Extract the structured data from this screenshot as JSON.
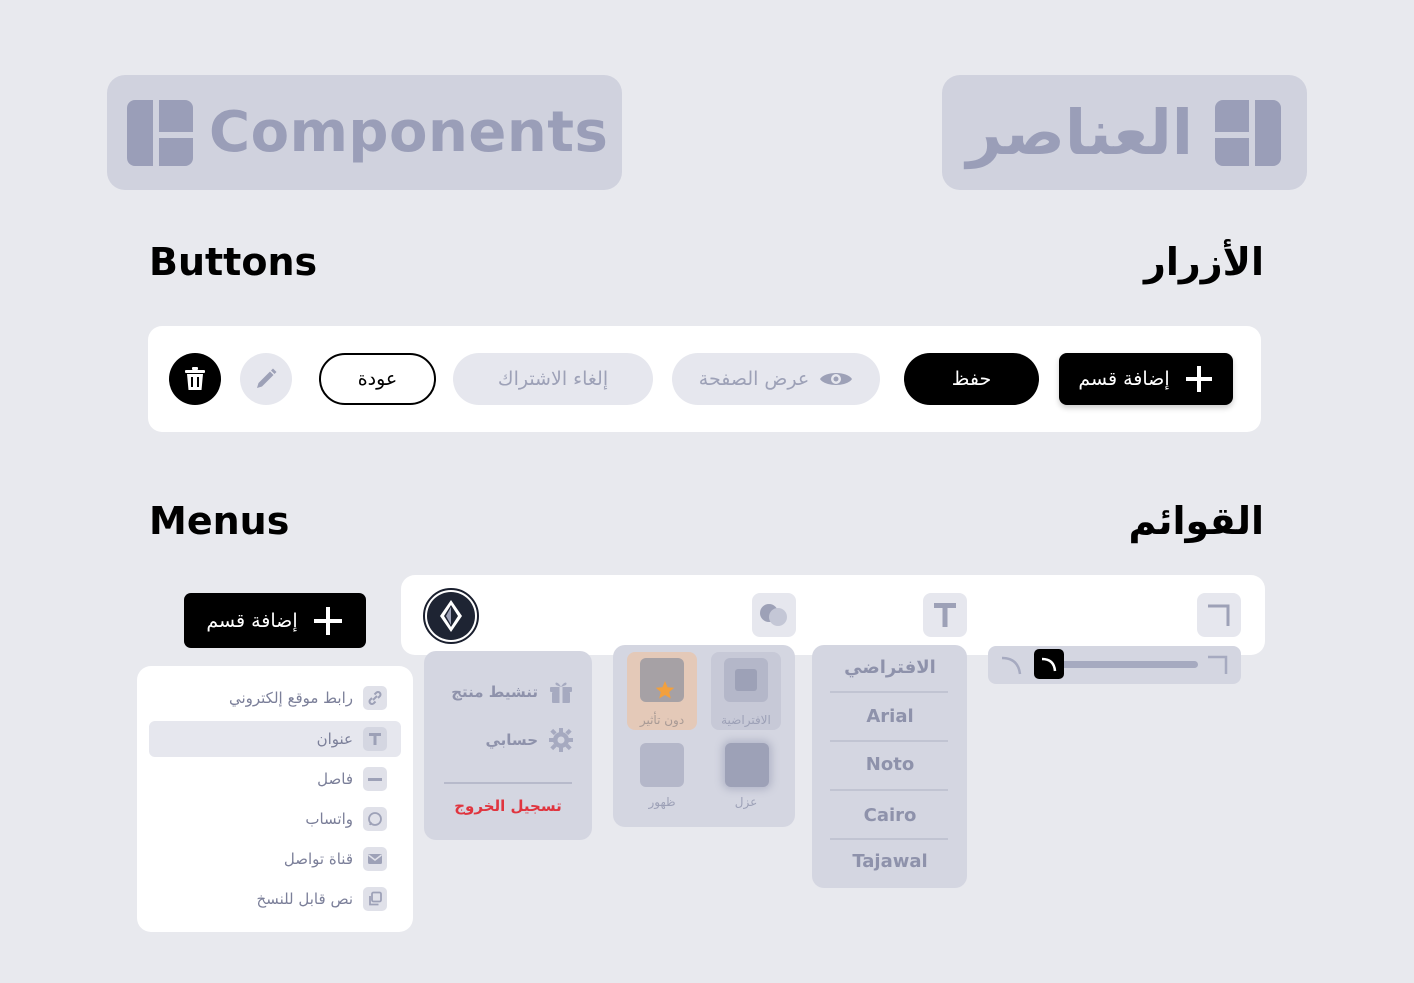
{
  "header": {
    "title_en": "Components",
    "title_ar": "العناصر"
  },
  "sections": {
    "buttons_en": "Buttons",
    "buttons_ar": "الأزرار",
    "menus_en": "Menus",
    "menus_ar": "القوائم"
  },
  "buttons": {
    "add_section": "إضافة قسم",
    "save": "حفظ",
    "view_page": "عرض الصفحة",
    "unsubscribe": "إلغاء الاشتراك",
    "back": "عودة"
  },
  "menus": {
    "add_section": "إضافة قسم",
    "dropdown_items": [
      {
        "label": "رابط موقع إلكتروني",
        "icon": "link-icon"
      },
      {
        "label": "عنوان",
        "icon": "text-icon"
      },
      {
        "label": "فاصل",
        "icon": "divider-icon"
      },
      {
        "label": "واتساب",
        "icon": "whatsapp-icon"
      },
      {
        "label": "قناة تواصل",
        "icon": "mail-icon"
      },
      {
        "label": "نص قابل للنسخ",
        "icon": "copy-icon"
      }
    ],
    "account_menu": {
      "activate_product": "تنشيط منتج",
      "my_account": "حسابي",
      "logout": "تسجيل الخروج"
    },
    "effects": {
      "default": "الافتراضية",
      "none": "دون تأثير",
      "isolate": "عزل",
      "appear": "ظهور"
    },
    "fonts": [
      "الافتراضي",
      "Arial",
      "Noto",
      "Cairo",
      "Tajawal"
    ]
  },
  "colors": {
    "background": "#e8e9ee",
    "accent": "#000000",
    "muted": "#d4d6e1",
    "danger": "#e0353f",
    "highlight": "#f2a03d"
  }
}
